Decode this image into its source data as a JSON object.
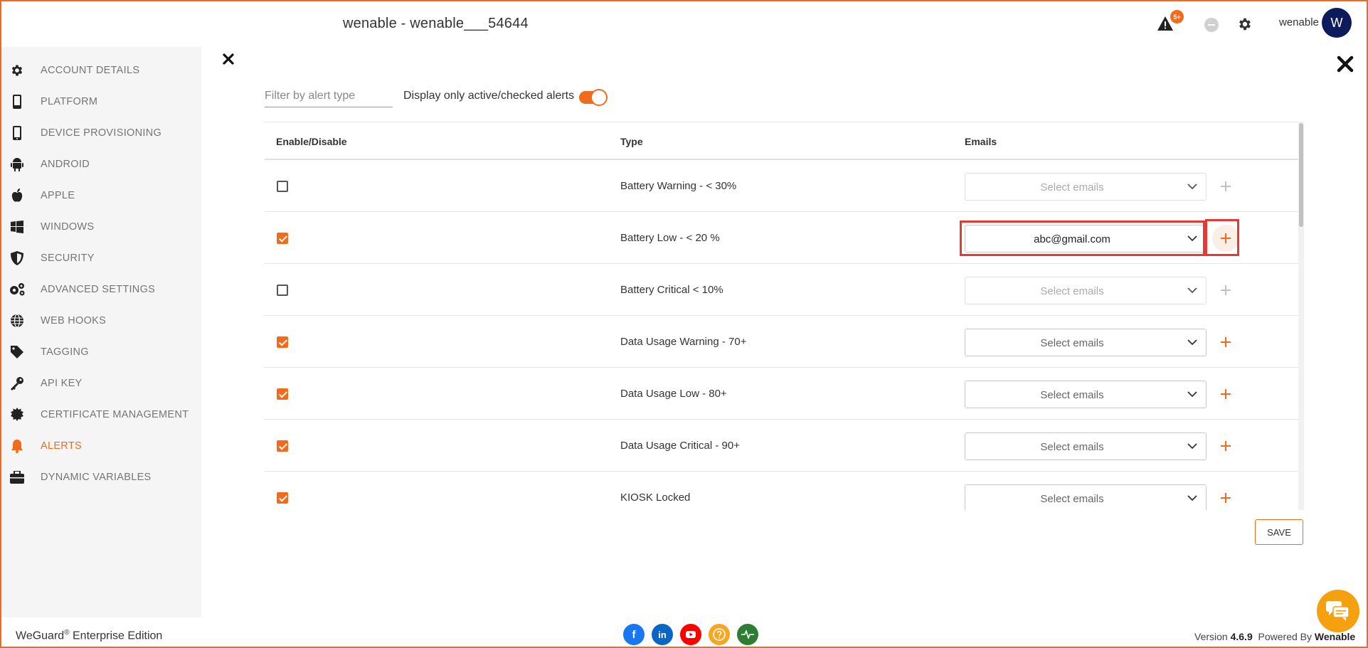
{
  "header": {
    "title": "wenable - wenable___54644",
    "alert_badge": "5+",
    "user_name": "wenable",
    "avatar_initial": "W"
  },
  "sidebar": {
    "items": [
      {
        "label": "ACCOUNT DETAILS",
        "icon": "gear-icon"
      },
      {
        "label": "PLATFORM",
        "icon": "phone-icon"
      },
      {
        "label": "DEVICE PROVISIONING",
        "icon": "mobile-device-icon"
      },
      {
        "label": "ANDROID",
        "icon": "android-icon"
      },
      {
        "label": "APPLE",
        "icon": "apple-icon"
      },
      {
        "label": "WINDOWS",
        "icon": "windows-icon"
      },
      {
        "label": "SECURITY",
        "icon": "shield-icon"
      },
      {
        "label": "ADVANCED SETTINGS",
        "icon": "gears-icon"
      },
      {
        "label": "WEB HOOKS",
        "icon": "globe-icon"
      },
      {
        "label": "TAGGING",
        "icon": "tag-icon"
      },
      {
        "label": "API KEY",
        "icon": "key-icon"
      },
      {
        "label": "CERTIFICATE MANAGEMENT",
        "icon": "certificate-icon"
      },
      {
        "label": "ALERTS",
        "icon": "bell-icon",
        "active": true
      },
      {
        "label": "DYNAMIC VARIABLES",
        "icon": "briefcase-icon"
      }
    ]
  },
  "main": {
    "filter_placeholder": "Filter by alert type",
    "toggle_label": "Display only active/checked alerts",
    "toggle_on": true,
    "table": {
      "headers": {
        "enable": "Enable/Disable",
        "type": "Type",
        "emails": "Emails"
      },
      "rows": [
        {
          "checked": false,
          "type": "Battery Warning - < 30%",
          "email": "Select emails"
        },
        {
          "checked": true,
          "type": "Battery Low - < 20 %",
          "email": "abc@gmail.com"
        },
        {
          "checked": false,
          "type": "Battery Critical < 10%",
          "email": "Select emails"
        },
        {
          "checked": true,
          "type": "Data Usage Warning - 70+",
          "email": "Select emails"
        },
        {
          "checked": true,
          "type": "Data Usage Low - 80+",
          "email": "Select emails"
        },
        {
          "checked": true,
          "type": "Data Usage Critical - 90+",
          "email": "Select emails"
        },
        {
          "checked": true,
          "type": "KIOSK Locked",
          "email": "Select emails"
        }
      ]
    },
    "save_label": "SAVE"
  },
  "footer": {
    "brand": "WeGuard",
    "registered": "®",
    "edition": " Enterprise Edition",
    "version_prefix": "Version ",
    "version": "4.6.9",
    "powered_prefix": "Powered By ",
    "powered_by": "Wenable"
  },
  "colors": {
    "accent": "#f26b1d",
    "avatar": "#0d1a5c",
    "facebook": "#1877f2",
    "linkedin": "#0a66c2",
    "youtube": "#ff0000",
    "help": "#f5a623",
    "status": "#2e7d32",
    "chat": "#f5a00f"
  }
}
